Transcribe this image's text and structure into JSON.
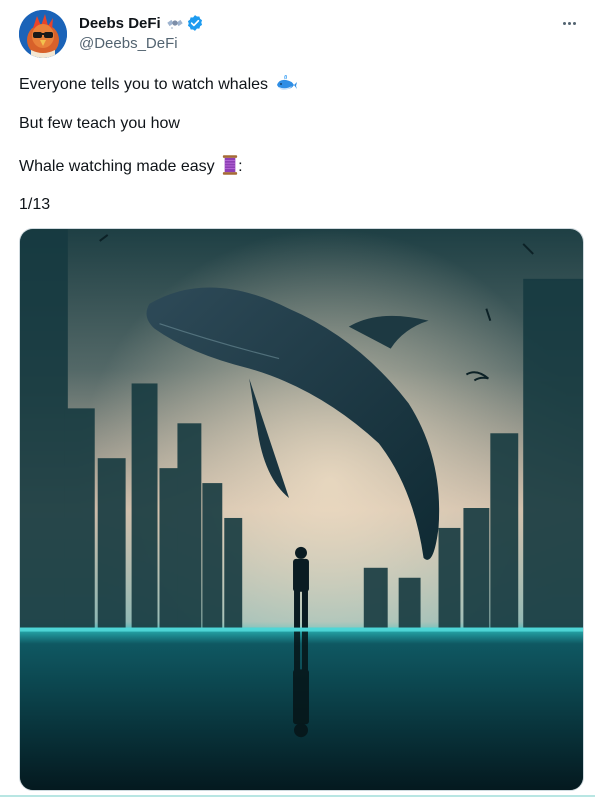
{
  "author": {
    "display_name": "Deebs DeFi",
    "handle": "@Deebs_DeFi",
    "avatar_icon": "rooster-avatar",
    "badge_icon": "satellite-icon",
    "verified_icon": "verified-badge-icon",
    "verified_color": "#1d9bf0"
  },
  "tweet": {
    "lines": [
      "Everyone tells you to watch whales",
      "But few teach you how",
      "Whale watching made easy",
      "1/13"
    ],
    "line1_emoji": "whale-emoji",
    "line3_emoji": "thread-emoji",
    "line3_suffix": ":"
  },
  "media": {
    "image_icon": "whale-over-city-image"
  },
  "actions": {
    "more_icon": "more-options-icon"
  },
  "colors": {
    "text_primary": "#0f1419",
    "text_secondary": "#536471",
    "border": "#cfd9de"
  }
}
